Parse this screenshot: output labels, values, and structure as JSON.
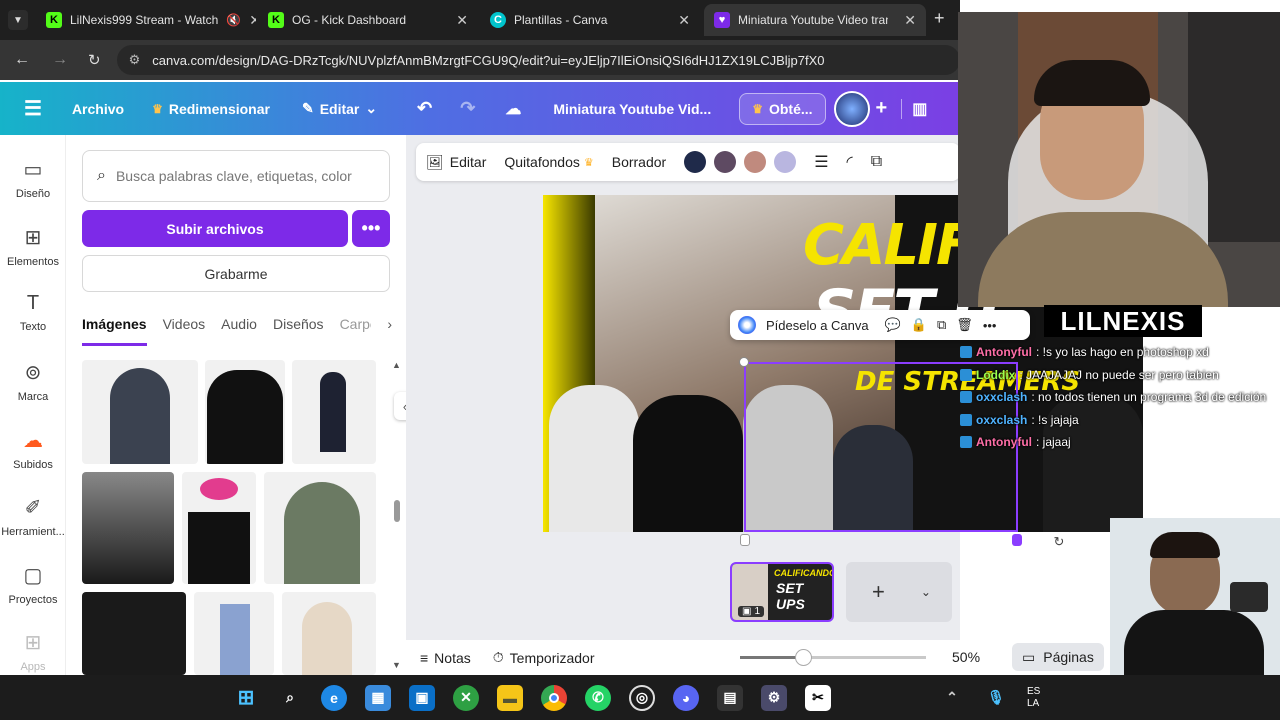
{
  "browser": {
    "tabs": [
      {
        "title": "LilNexis999 Stream - Watch",
        "fav": "K"
      },
      {
        "title": "OG - Kick Dashboard",
        "fav": "K"
      },
      {
        "title": "Plantillas - Canva",
        "fav": "C"
      },
      {
        "title": "Miniatura Youtube Video transm",
        "fav": "♥"
      }
    ],
    "url": "canva.com/design/DAG-DRzTcgk/NUVplzfAnmBMzrgtFCGU9Q/edit?ui=eyJEljp7IlEiOnsiQSI6dHJ1ZX19LCJBljp7fX0"
  },
  "header": {
    "archivo": "Archivo",
    "redimensionar": "Redimensionar",
    "editar": "Editar",
    "doc_title": "Miniatura Youtube Vid...",
    "obtener": "Obté..."
  },
  "rail": [
    "Diseño",
    "Elementos",
    "Texto",
    "Marca",
    "Subidos",
    "Herramient...",
    "Proyectos",
    "Apps"
  ],
  "panel": {
    "search_placeholder": "Busca palabras clave, etiquetas, color",
    "upload": "Subir archivos",
    "more": "•••",
    "record": "Grabarme",
    "tabs": [
      "Imágenes",
      "Videos",
      "Audio",
      "Diseños",
      "Carpe"
    ]
  },
  "toolbar": {
    "editar": "Editar",
    "quitafondos": "Quitafondos",
    "borrador": "Borrador",
    "colors": [
      "#1f2a4a",
      "#5e4a62",
      "#c08a7e",
      "#b9b6e0"
    ]
  },
  "design": {
    "line1": "CALIFIC",
    "line2": "SET U",
    "line3": "DE STREAMERS"
  },
  "ask_canva": "Pídeselo a Canva",
  "page_thumb": {
    "line1": "CALIFICANDO",
    "line2": "SET UPS",
    "count": "1"
  },
  "bottom": {
    "notas": "Notas",
    "timer": "Temporizador",
    "zoom": "50%",
    "pages": "Páginas",
    "zoom_level": 0.5
  },
  "stream": {
    "name": "LILNEXIS",
    "chat": [
      {
        "user": "Antonyful",
        "color": "#ff6fa8",
        "msg": ": !s yo las hago en photoshop xd"
      },
      {
        "user": "Loddix",
        "color": "#9dff4f",
        "msg": ": JAAJAJAJ no puede ser pero tabien"
      },
      {
        "user": "oxxclash",
        "color": "#4fb3ff",
        "msg": ": no todos tienen un programa 3d de edición"
      },
      {
        "user": "oxxclash",
        "color": "#4fb3ff",
        "msg": ": !s jajaja"
      },
      {
        "user": "Antonyful",
        "color": "#ff6fa8",
        "msg": ": jajaaj"
      }
    ]
  },
  "taskbar": {
    "clock_top": "ES",
    "clock_bottom": "LA"
  }
}
